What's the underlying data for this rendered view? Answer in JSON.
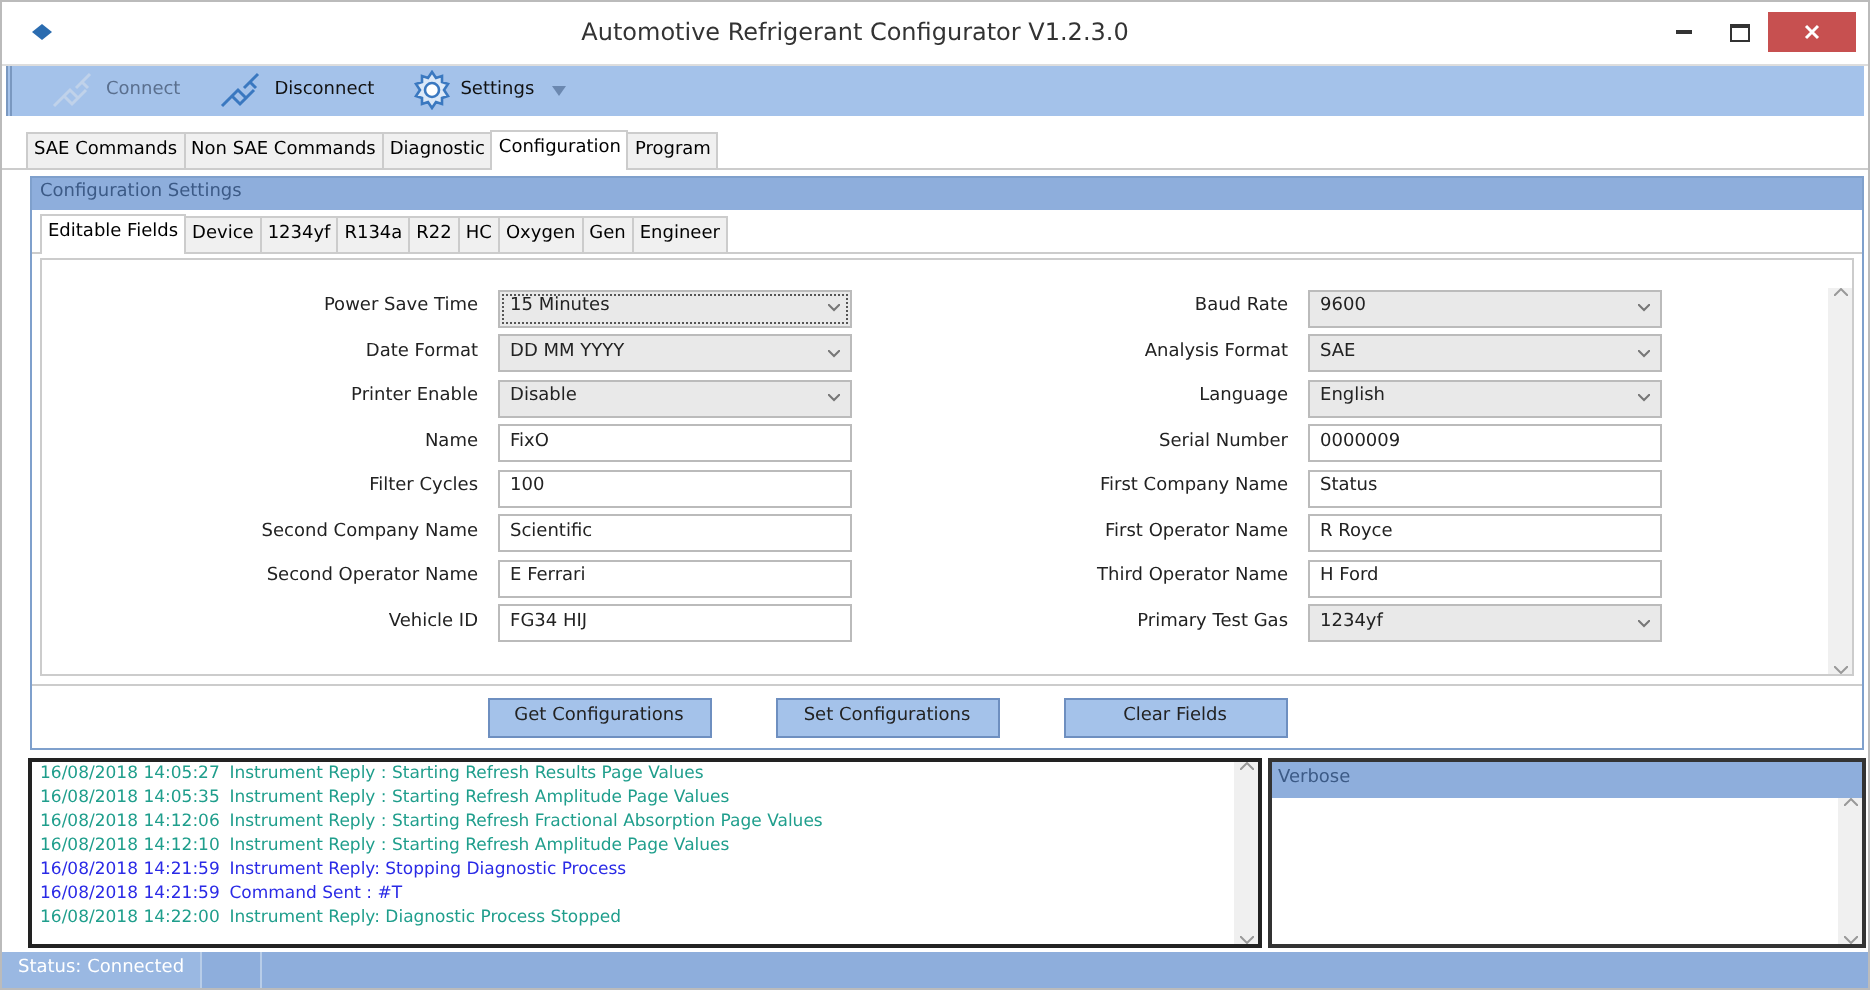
{
  "window": {
    "title": "Automotive Refrigerant Configurator V1.2.3.0"
  },
  "toolbar": [
    {
      "label": "Connect",
      "kind": "plug",
      "disabled": true,
      "dropdown": false
    },
    {
      "label": "Disconnect",
      "kind": "plug",
      "disabled": false,
      "dropdown": false
    },
    {
      "label": "Settings",
      "kind": "gear",
      "disabled": false,
      "dropdown": true
    }
  ],
  "tabs": [
    {
      "label": "SAE Commands",
      "selected": false
    },
    {
      "label": "Non SAE Commands",
      "selected": false
    },
    {
      "label": "Diagnostic",
      "selected": false
    },
    {
      "label": "Configuration",
      "selected": true
    },
    {
      "label": "Program",
      "selected": false
    }
  ],
  "panel": {
    "title": "Configuration Settings",
    "tabs": [
      {
        "label": "Editable Fields",
        "selected": true
      },
      {
        "label": "Device",
        "selected": false
      },
      {
        "label": "1234yf",
        "selected": false
      },
      {
        "label": "R134a",
        "selected": false
      },
      {
        "label": "R22",
        "selected": false
      },
      {
        "label": "HC",
        "selected": false
      },
      {
        "label": "Oxygen",
        "selected": false
      },
      {
        "label": "Gen",
        "selected": false
      },
      {
        "label": "Engineer",
        "selected": false
      }
    ],
    "left_fields": [
      {
        "label": "Power Save Time",
        "kind": "select",
        "value": "15 Minutes",
        "focused": true
      },
      {
        "label": "Date Format",
        "kind": "select",
        "value": "DD MM YYYY",
        "focused": false
      },
      {
        "label": "Printer Enable",
        "kind": "select",
        "value": "Disable",
        "focused": false
      },
      {
        "label": "Name",
        "kind": "text",
        "value": "FixO",
        "focused": false
      },
      {
        "label": "Filter Cycles",
        "kind": "text",
        "value": "100",
        "focused": false
      },
      {
        "label": "Second Company Name",
        "kind": "text",
        "value": "Scientific",
        "focused": false
      },
      {
        "label": "Second Operator Name",
        "kind": "text",
        "value": "E Ferrari",
        "focused": false
      },
      {
        "label": "Vehicle ID",
        "kind": "text",
        "value": "FG34 HIJ",
        "focused": false
      }
    ],
    "right_fields": [
      {
        "label": "Baud Rate",
        "kind": "select",
        "value": "9600",
        "focused": false
      },
      {
        "label": "Analysis Format",
        "kind": "select",
        "value": "SAE",
        "focused": false
      },
      {
        "label": "Language",
        "kind": "select",
        "value": "English",
        "focused": false
      },
      {
        "label": "Serial Number",
        "kind": "text",
        "value": "0000009",
        "focused": false
      },
      {
        "label": "First Company Name",
        "kind": "text",
        "value": "Status",
        "focused": false
      },
      {
        "label": "First Operator Name",
        "kind": "text",
        "value": "R Royce",
        "focused": false
      },
      {
        "label": "Third Operator Name",
        "kind": "text",
        "value": "H Ford",
        "focused": false
      },
      {
        "label": "Primary Test Gas",
        "kind": "select",
        "value": "1234yf",
        "focused": false
      }
    ],
    "buttons": [
      "Get Configurations",
      "Set Configurations",
      "Clear Fields"
    ]
  },
  "log": [
    {
      "time": "16/08/2018 14:05:27",
      "message": "Instrument Reply : Starting Refresh Results Page Values",
      "color": "#1f9e8c"
    },
    {
      "time": "16/08/2018 14:05:35",
      "message": "Instrument Reply : Starting Refresh Amplitude Page Values",
      "color": "#1f9e8c"
    },
    {
      "time": "16/08/2018 14:12:06",
      "message": "Instrument Reply : Starting Refresh Fractional Absorption Page Values",
      "color": "#1f9e8c"
    },
    {
      "time": "16/08/2018 14:12:10",
      "message": "Instrument Reply : Starting Refresh Amplitude Page Values",
      "color": "#1f9e8c"
    },
    {
      "time": "16/08/2018 14:21:59",
      "message": "Instrument Reply: Stopping Diagnostic Process",
      "color": "#2a2ae6"
    },
    {
      "time": "16/08/2018 14:21:59",
      "message": "Command Sent : #T",
      "color": "#2a2ae6"
    },
    {
      "time": "16/08/2018 14:22:00",
      "message": "Instrument Reply: Diagnostic Process Stopped",
      "color": "#1f9e8c"
    }
  ],
  "verbose": {
    "title": "Verbose"
  },
  "status_bar": {
    "text": "Status: Connected"
  }
}
